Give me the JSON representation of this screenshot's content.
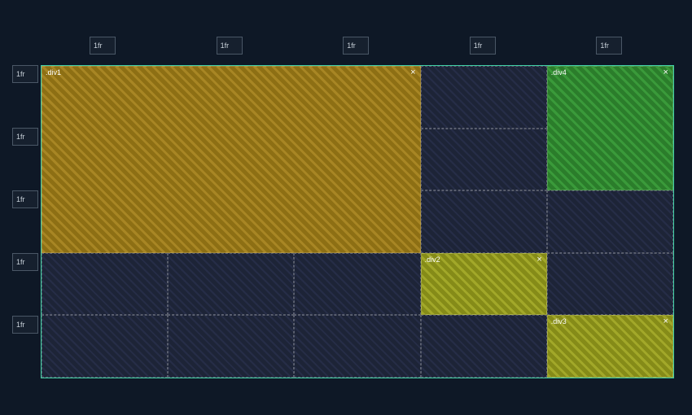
{
  "grid": {
    "cols": 5,
    "rows": 5,
    "col_labels": [
      "1fr",
      "1fr",
      "1fr",
      "1fr",
      "1fr"
    ],
    "row_labels": [
      "1fr",
      "1fr",
      "1fr",
      "1fr",
      "1fr"
    ]
  },
  "areas": {
    "div1": {
      "name": ".div1",
      "close": "×",
      "col_start": 1,
      "col_end": 3,
      "row_start": 1,
      "row_end": 3,
      "color": "#a88624"
    },
    "div2": {
      "name": ".div2",
      "close": "×",
      "col_start": 4,
      "col_end": 4,
      "row_start": 4,
      "row_end": 4,
      "color": "#a2a829"
    },
    "div3": {
      "name": ".div3",
      "close": "×",
      "col_start": 5,
      "col_end": 5,
      "row_start": 5,
      "row_end": 5,
      "color": "#a2a829"
    },
    "div4": {
      "name": ".div4",
      "close": "×",
      "col_start": 5,
      "col_end": 5,
      "row_start": 1,
      "row_end": 2,
      "color": "#3a9a3a"
    }
  },
  "colors": {
    "page_bg": "#0e1826",
    "grid_border": "#3fd0a6",
    "cell_bg": "#1d2437",
    "label_border": "#4a5766"
  }
}
